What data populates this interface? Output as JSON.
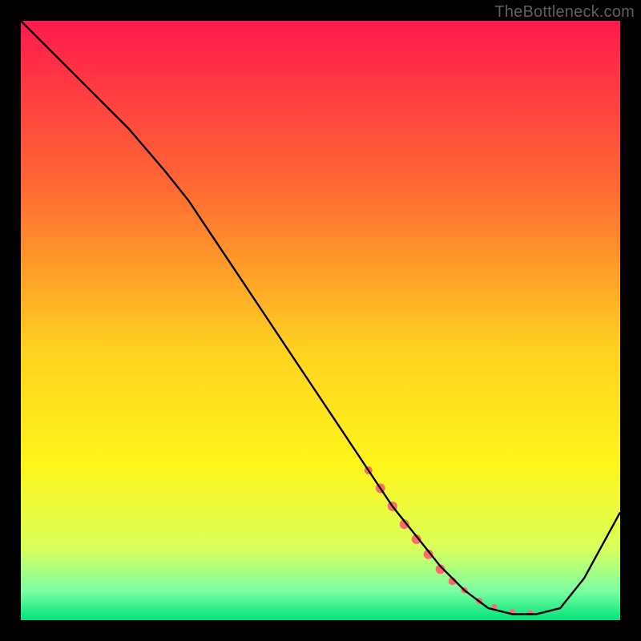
{
  "attribution": "TheBottleneck.com",
  "chart_data": {
    "type": "line",
    "title": "",
    "xlabel": "",
    "ylabel": "",
    "xlim": [
      0,
      100
    ],
    "ylim": [
      0,
      100
    ],
    "background": {
      "type": "vertical-gradient",
      "stops": [
        {
          "offset": 0.0,
          "color": "#ff1a4d"
        },
        {
          "offset": 0.28,
          "color": "#ff6a33"
        },
        {
          "offset": 0.55,
          "color": "#ffd21f"
        },
        {
          "offset": 0.74,
          "color": "#fff51a"
        },
        {
          "offset": 0.88,
          "color": "#d9ff5a"
        },
        {
          "offset": 0.95,
          "color": "#7dffa3"
        },
        {
          "offset": 1.0,
          "color": "#00e47a"
        }
      ]
    },
    "series": [
      {
        "name": "bottleneck-curve",
        "color": "#000000",
        "x": [
          0,
          6,
          12,
          18,
          24,
          28,
          34,
          40,
          46,
          52,
          58,
          62,
          66,
          70,
          74,
          78,
          82,
          86,
          90,
          94,
          100
        ],
        "y": [
          100,
          94,
          88,
          82,
          75,
          70,
          61,
          52,
          43,
          34,
          25,
          19,
          14,
          9,
          5,
          2,
          1,
          1,
          2,
          7,
          18
        ]
      }
    ],
    "highlight": {
      "name": "selected-range",
      "color": "#ff6b6b",
      "points": [
        {
          "x": 58,
          "y": 25,
          "r": 5
        },
        {
          "x": 60,
          "y": 22,
          "r": 6
        },
        {
          "x": 62,
          "y": 19,
          "r": 6
        },
        {
          "x": 64,
          "y": 16,
          "r": 6
        },
        {
          "x": 66,
          "y": 13.5,
          "r": 6
        },
        {
          "x": 68,
          "y": 11,
          "r": 6
        },
        {
          "x": 70,
          "y": 8.5,
          "r": 6
        },
        {
          "x": 72,
          "y": 6.5,
          "r": 5
        },
        {
          "x": 74,
          "y": 5,
          "r": 4
        },
        {
          "x": 76.5,
          "y": 3.2,
          "r": 4
        },
        {
          "x": 79,
          "y": 2.2,
          "r": 3.5
        },
        {
          "x": 82,
          "y": 1.4,
          "r": 3.5
        },
        {
          "x": 85,
          "y": 1.2,
          "r": 3.5
        }
      ]
    }
  }
}
